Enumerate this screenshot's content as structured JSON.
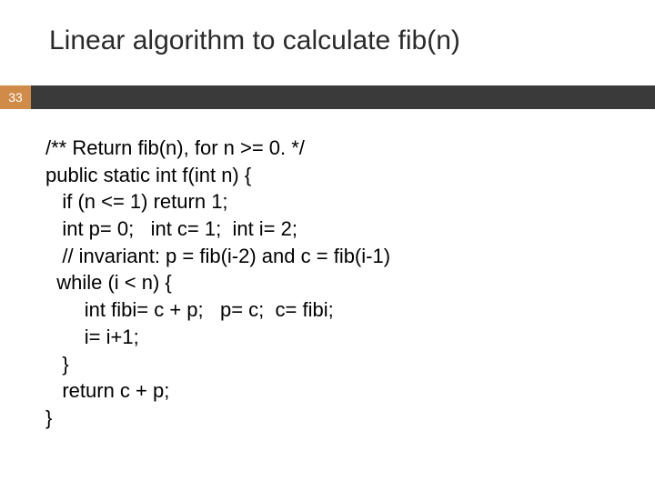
{
  "slide": {
    "title": "Linear algorithm to calculate fib(n)",
    "number": "33",
    "code": {
      "l1": "/** Return fib(n), for n >= 0. */",
      "l2": "public static int f(int n) {",
      "l3": "   if (n <= 1) return 1;",
      "l4": "   int p= 0;   int c= 1;  int i= 2;",
      "l5": "   // invariant: p = fib(i-2) and c = fib(i-1)",
      "l6": "  while (i < n) {",
      "l7": "       int fibi= c + p;   p= c;  c= fibi;",
      "l8": "       i= i+1;",
      "l9": "   }",
      "l10": "   return c + p;",
      "l11": "}"
    }
  }
}
